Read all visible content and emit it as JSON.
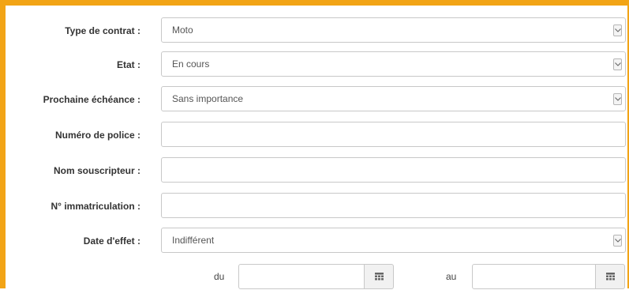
{
  "form": {
    "contract_type": {
      "label": "Type de contrat :",
      "value": "Moto",
      "icon": "chevron-down-icon"
    },
    "state": {
      "label": "Etat :",
      "value": "En cours",
      "icon": "chevron-down-icon"
    },
    "next_due": {
      "label": "Prochaine échéance :",
      "value": "Sans importance",
      "icon": "chevron-down-icon"
    },
    "policy_number": {
      "label": "Numéro de police :",
      "value": ""
    },
    "subscriber_name": {
      "label": "Nom souscripteur :",
      "value": ""
    },
    "registration": {
      "label": "N° immatriculation :",
      "value": ""
    },
    "effective_date": {
      "label": "Date d'effet :",
      "value": "Indifférent",
      "icon": "chevron-down-icon"
    },
    "date_range": {
      "from_label": "du",
      "from_value": "",
      "to_label": "au",
      "to_value": "",
      "icon": "calendar-icon"
    }
  },
  "colors": {
    "accent_border": "#f2a416",
    "field_border": "#c8c8c8",
    "label_text": "#333333"
  }
}
